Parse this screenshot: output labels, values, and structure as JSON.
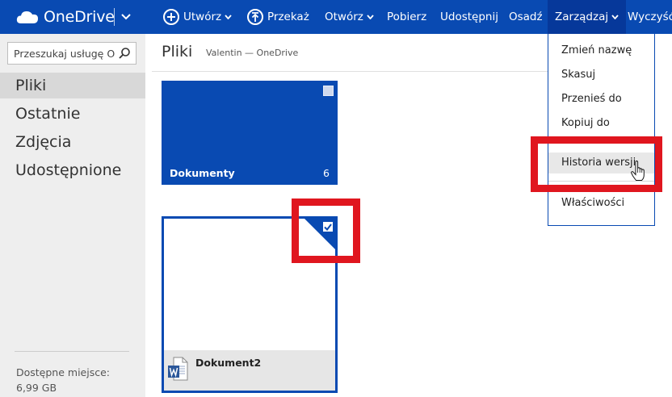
{
  "app": {
    "name": "OneDrive",
    "logo_icon": "cloud-icon"
  },
  "commands": {
    "create": "Utwórz",
    "upload": "Przekaż",
    "open": "Otwórz",
    "download": "Pobierz",
    "share": "Udostępnij",
    "embed": "Osadź",
    "manage": "Zarządzaj",
    "clear": "Wyczyść"
  },
  "sidebar": {
    "search_placeholder": "Przeszukaj usługę O",
    "items": [
      {
        "label": "Pliki",
        "selected": true
      },
      {
        "label": "Ostatnie",
        "selected": false
      },
      {
        "label": "Zdjęcia",
        "selected": false
      },
      {
        "label": "Udostępnione",
        "selected": false
      }
    ],
    "space_label": "Dostępne miejsce:",
    "space_value": "6,99 GB"
  },
  "main": {
    "title": "Pliki",
    "subtitle": "Valentin — OneDrive",
    "tiles": [
      {
        "name": "Dokumenty",
        "type": "folder",
        "count": "6",
        "selected": false
      },
      {
        "name": "Dokument2",
        "type": "word-document",
        "selected": true
      }
    ]
  },
  "manage_menu": {
    "items": [
      {
        "label": "Zmień nazwę"
      },
      {
        "label": "Skasuj"
      },
      {
        "label": "Przenieś do"
      },
      {
        "label": "Kopiuj do"
      },
      {
        "label": "Historia wersji",
        "hover": true
      },
      {
        "label": "Właściwości"
      }
    ]
  },
  "colors": {
    "brand": "#094ab2",
    "highlight": "#e0161f",
    "sidebar_bg": "#eeeeee"
  }
}
